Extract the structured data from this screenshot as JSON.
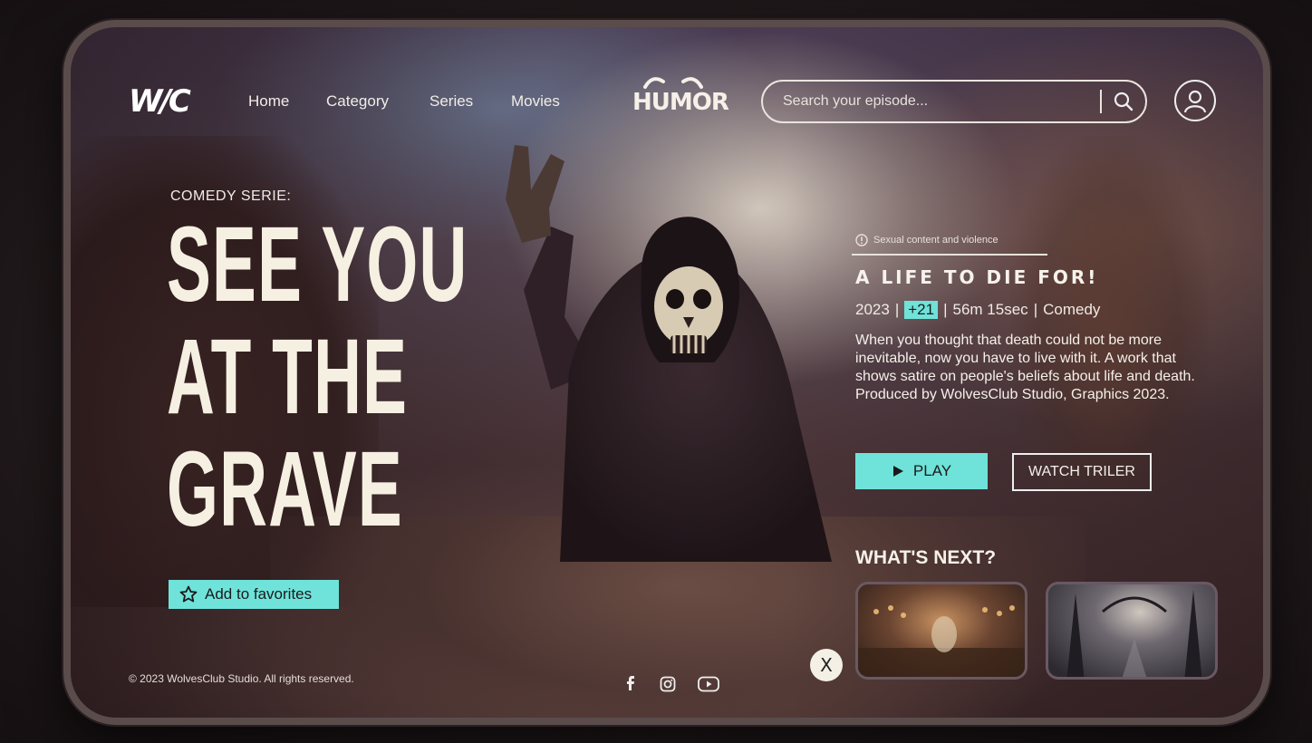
{
  "header": {
    "logo": "W/C",
    "nav": [
      "Home",
      "Category",
      "Series",
      "Movies"
    ],
    "brand": "HUMOR",
    "search_placeholder": "Search your episode..."
  },
  "hero": {
    "kicker": "COMEDY SERIE:",
    "title_lines": [
      "SEE YOU",
      "AT THE",
      "GRAVE"
    ],
    "favorite_label": "Add to favorites"
  },
  "episode": {
    "warning": "Sexual content and violence",
    "title": "A LIFE TO DIE FOR!",
    "year": "2023",
    "age": "+21",
    "duration": "56m 15sec",
    "genre": "Comedy",
    "description": "When you thought that death could not be more inevitable, now you have to live with it. A work that shows satire on people's beliefs about life and death. Produced by WolvesClub Studio, Graphics 2023.",
    "play_label": "PLAY",
    "trailer_label": "WATCH TRILER"
  },
  "next": {
    "heading": "WHAT'S NEXT?"
  },
  "footer": {
    "copyright": "© 2023 WolvesClub Studio. All rights reserved.",
    "close_label": "X"
  },
  "colors": {
    "accent": "#6fe3da",
    "text": "#f6f0e2"
  }
}
